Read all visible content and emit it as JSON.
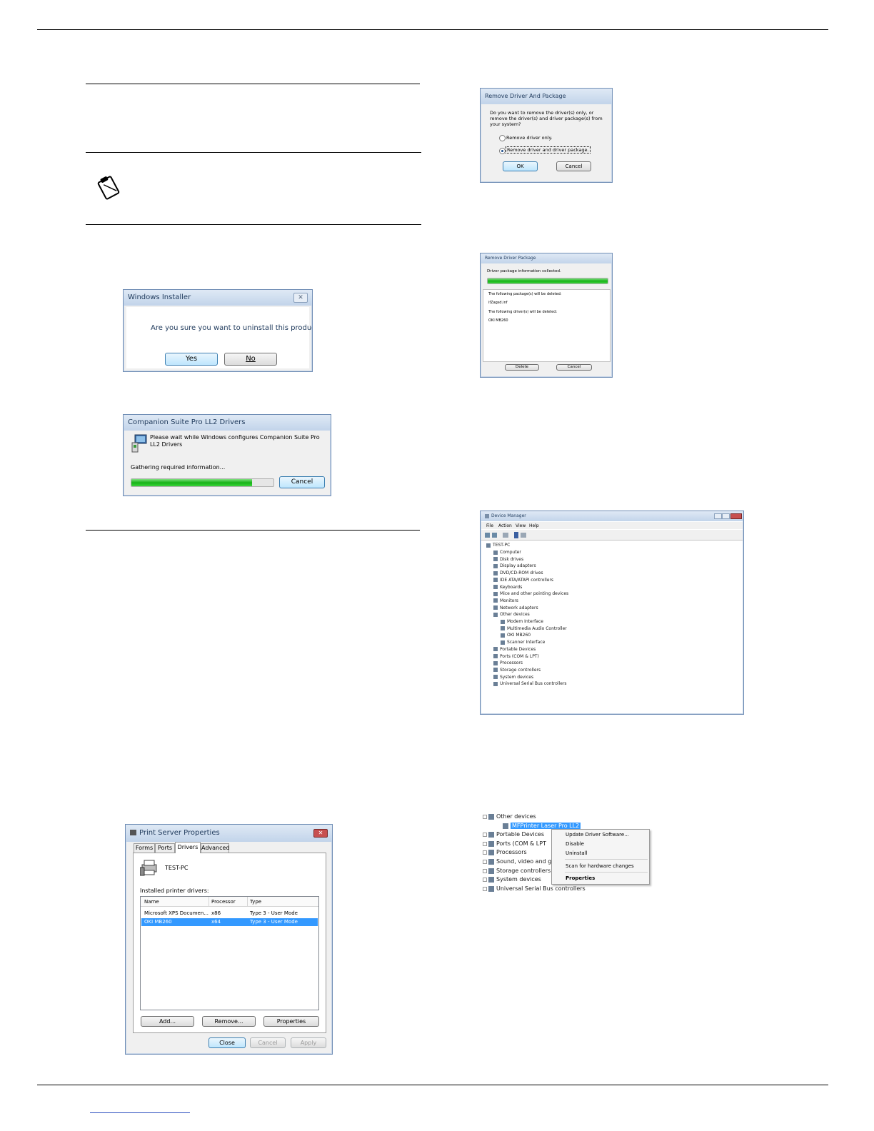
{
  "windows_installer": {
    "title": "Windows Installer",
    "message": "Are you sure you want to uninstall this product?",
    "yes_label": "Yes",
    "no_label": "No"
  },
  "companion_drivers": {
    "title": "Companion Suite Pro LL2 Drivers",
    "message": "Please wait while Windows configures Companion Suite Pro LL2 Drivers",
    "status": "Gathering required information...",
    "progress": 0.85,
    "cancel_label": "Cancel"
  },
  "print_server": {
    "title": "Print Server Properties",
    "tabs": [
      "Forms",
      "Ports",
      "Drivers",
      "Advanced"
    ],
    "active_tab": "Drivers",
    "server_name": "TEST-PC",
    "list_label": "Installed printer drivers:",
    "columns": [
      "Name",
      "Processor",
      "Type"
    ],
    "rows": [
      [
        "Microsoft XPS Documen...",
        "x86",
        "Type 3 - User Mode"
      ],
      [
        "OKI MB260",
        "x64",
        "Type 3 - User Mode"
      ]
    ],
    "add_label": "Add...",
    "remove_label": "Remove...",
    "properties_label": "Properties",
    "close_label": "Close",
    "cancel_label": "Cancel",
    "apply_label": "Apply"
  },
  "remove_driver": {
    "title": "Remove Driver And Package",
    "question": "Do you want to remove the driver(s) only, or remove the driver(s) and driver package(s) from your system?",
    "option1": "Remove driver only.",
    "option2": "Remove driver and driver package.",
    "ok_label": "OK",
    "cancel_label": "Cancel"
  },
  "remove_package": {
    "title": "Remove Driver Package",
    "status": "Driver package information collected.",
    "progress": 1.0,
    "line1": "The following package(s) will be deleted:",
    "line2": "ifZagsd.inf",
    "line3": "The following driver(s) will be deleted:",
    "line4": "OKI MB260",
    "delete_label": "Delete",
    "cancel_label": "Cancel"
  },
  "device_manager": {
    "title": "Device Manager",
    "menu": [
      "File",
      "Action",
      "View",
      "Help"
    ],
    "root": "TEST-PC",
    "items": [
      "Computer",
      "Disk drives",
      "Display adapters",
      "DVD/CD-ROM drives",
      "IDE ATA/ATAPI controllers",
      "Keyboards",
      "Mice and other pointing devices",
      "Monitors",
      "Network adapters",
      "Other devices",
      "Modem Interface",
      "Multimedia Audio Controller",
      "OKI MB260",
      "Scanner Interface",
      "Portable Devices",
      "Ports (COM & LPT)",
      "Processors",
      "Storage controllers",
      "System devices",
      "Universal Serial Bus controllers"
    ]
  },
  "context_tree": {
    "items": [
      "Other devices",
      "MFPrinter Laser Pro LL2",
      "Portable Devices",
      "Ports (COM & LPT",
      "Processors",
      "Sound, video and g",
      "Storage controllers",
      "System devices",
      "Universal Serial Bus controllers"
    ],
    "menu": [
      "Update Driver Software...",
      "Disable",
      "Uninstall",
      "Scan for hardware changes",
      "Properties"
    ]
  }
}
